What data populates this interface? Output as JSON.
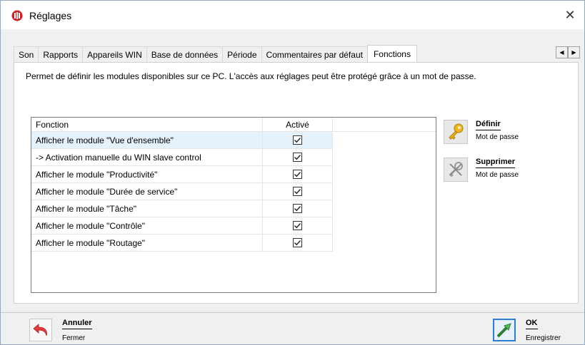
{
  "window": {
    "title": "Réglages",
    "close_symbol": "✕"
  },
  "tabs": [
    {
      "label": "Son"
    },
    {
      "label": "Rapports"
    },
    {
      "label": "Appareils WIN"
    },
    {
      "label": "Base de données"
    },
    {
      "label": "Période"
    },
    {
      "label": "Commentaires par défaut"
    },
    {
      "label": "Fonctions",
      "active": true
    }
  ],
  "tab_scroll": {
    "left": "◀",
    "right": "▶"
  },
  "panel": {
    "description": "Permet de définir les modules disponibles sur ce PC. L'accès aux réglages peut être protégé grâce à un mot de passe."
  },
  "grid": {
    "headers": {
      "function": "Fonction",
      "active": "Activé"
    },
    "rows": [
      {
        "function": "Afficher le module \"Vue d'ensemble\"",
        "active": true,
        "selected": true
      },
      {
        "function": "-> Activation manuelle du WIN slave control",
        "active": true
      },
      {
        "function": "Afficher le module \"Productivité\"",
        "active": true
      },
      {
        "function": "Afficher le module \"Durée de service\"",
        "active": true
      },
      {
        "function": "Afficher le module \"Tâche\"",
        "active": true
      },
      {
        "function": "Afficher le module \"Contrôle\"",
        "active": true
      },
      {
        "function": "Afficher le module \"Routage\"",
        "active": true
      }
    ]
  },
  "side_buttons": {
    "define": {
      "title": "Définir",
      "subtitle": "Mot de passe",
      "icon": "key-icon"
    },
    "delete": {
      "title": "Supprimer",
      "subtitle": "Mot de passe",
      "icon": "key-delete-icon"
    }
  },
  "footer": {
    "cancel": {
      "title": "Annuler",
      "subtitle": "Fermer",
      "icon": "undo-arrow-icon"
    },
    "ok": {
      "title": "OK",
      "subtitle": "Enregistrer",
      "icon": "check-arrow-icon"
    }
  },
  "colors": {
    "selection": "#e5f1fb",
    "accent": "#2a7fd6",
    "app_icon": "#d21f26",
    "ok_green": "#5cb85c",
    "cancel_red": "#e23c3c"
  }
}
